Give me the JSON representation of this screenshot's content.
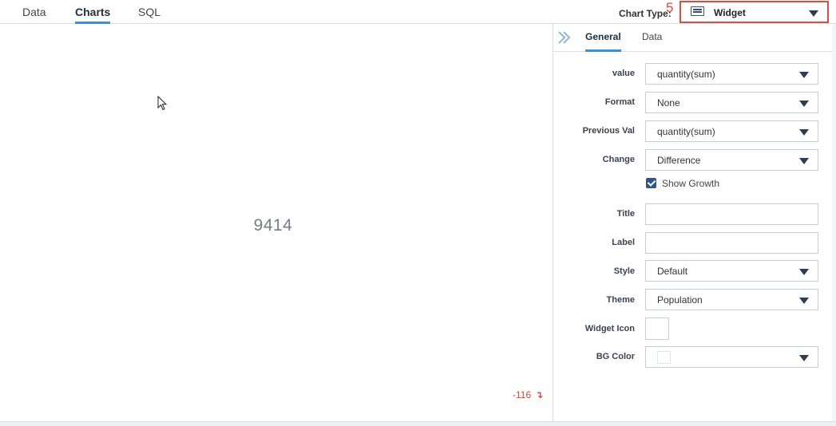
{
  "tabs": [
    {
      "label": "Data",
      "active": false
    },
    {
      "label": "Charts",
      "active": true
    },
    {
      "label": "SQL",
      "active": false
    }
  ],
  "chart_type": {
    "label": "Chart Type:",
    "step_number": "5",
    "value": "Widget",
    "icon": "widget-icon",
    "highlight_color": "#e04a3f"
  },
  "preview": {
    "value": "9414",
    "change": "-116",
    "change_icon": "down-arrow-icon",
    "change_color": "#d9443a"
  },
  "panel": {
    "tabs": [
      {
        "label": "General",
        "active": true
      },
      {
        "label": "Data",
        "active": false
      }
    ],
    "fields": {
      "value": {
        "label": "value",
        "value": "quantity(sum)"
      },
      "format": {
        "label": "Format",
        "value": "None"
      },
      "previous_val": {
        "label": "Previous Val",
        "value": "quantity(sum)"
      },
      "change": {
        "label": "Change",
        "value": "Difference"
      },
      "show_growth": {
        "label": "Show Growth",
        "checked": true
      },
      "title": {
        "label": "Title",
        "value": ""
      },
      "label": {
        "label": "Label",
        "value": ""
      },
      "style": {
        "label": "Style",
        "value": "Default"
      },
      "theme": {
        "label": "Theme",
        "value": "Population"
      },
      "widget_icon": {
        "label": "Widget Icon"
      },
      "bg_color": {
        "label": "BG Color"
      }
    }
  },
  "accent_color": "#3d8fd6"
}
